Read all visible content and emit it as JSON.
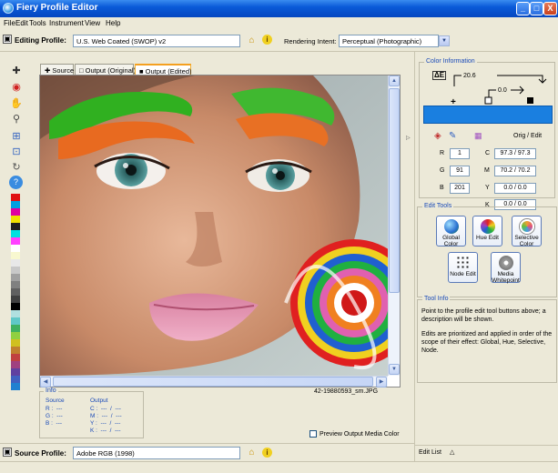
{
  "window": {
    "title": "Fiery Profile Editor",
    "minimize": "_",
    "maximize": "□",
    "close": "X"
  },
  "menu": [
    "File",
    "Edit",
    "Tools",
    "Instrument",
    "View",
    "Help"
  ],
  "toolbar": {
    "editing_label": "Editing Profile:",
    "editing_value": "U.S. Web Coated (SWOP) v2",
    "rendering_label": "Rendering Intent:",
    "rendering_value": "Perceptual (Photographic)"
  },
  "tabs": [
    {
      "label": "Source",
      "icon": "plus-icon"
    },
    {
      "label": "Output (Original)",
      "icon": "hollow-square-icon"
    },
    {
      "label": "Output (Edited)",
      "icon": "filled-square-icon",
      "active": true
    }
  ],
  "left_tools": [
    "eyedropper-plus-icon",
    "target-icon",
    "hand-icon",
    "zoom-icon",
    "fit-icon",
    "actual-size-icon",
    "rotate-icon",
    "help-icon"
  ],
  "swatches": [
    "#e01010",
    "#00a0e0",
    "#e000a0",
    "#f0e000",
    "#202020",
    "#00e0e0",
    "#ff40ff",
    "#ffffff",
    "#f8f8d0",
    "#e8e8e8",
    "#c8c8c8",
    "#a0a0a0",
    "#808080",
    "#606060",
    "#404040",
    "#000000",
    "#b0e0e0",
    "#60c8c8",
    "#40b060",
    "#90d040",
    "#d0c020",
    "#c08030",
    "#c04040",
    "#a04080",
    "#6040a0",
    "#4060c0",
    "#2080d0"
  ],
  "image": {
    "filename": "42-19880593_sm.JPG"
  },
  "info": {
    "legend": "Info",
    "source_title": "Source",
    "output_title": "Output",
    "source_lines": [
      "R :  ---",
      "G :  ---",
      "B :  ---"
    ],
    "output_lines": [
      "C :  ---  /  ---",
      "M :  ---  /  ---",
      "Y :  ---  /  ---",
      "K :  ---  /  ---"
    ]
  },
  "preview_label": "Preview Output Media Color",
  "source_profile": {
    "label": "Source Profile:",
    "value": "Adobe RGB (1998)"
  },
  "color_info": {
    "legend": "Color Information",
    "top_value": "20.6",
    "mid_value": "0.0",
    "orig_edit_label": "Orig / Edit",
    "rgb": [
      {
        "label": "R",
        "value": "1"
      },
      {
        "label": "G",
        "value": "91"
      },
      {
        "label": "B",
        "value": "201"
      }
    ],
    "cmyk": [
      {
        "label": "C",
        "value": "97.3 / 97.3"
      },
      {
        "label": "M",
        "value": "70.2 / 70.2"
      },
      {
        "label": "Y",
        "value": "0.0 / 0.0"
      },
      {
        "label": "K",
        "value": "0.0 / 0.0"
      }
    ]
  },
  "edit_tools": {
    "legend": "Edit Tools",
    "buttons": [
      {
        "label": "Global Color",
        "icon": "globe-icon"
      },
      {
        "label": "Hue Edit",
        "icon": "color-wheel-icon"
      },
      {
        "label": "Selective Color",
        "icon": "crosshair-icon"
      },
      {
        "label": "Node Edit",
        "icon": "node-grid-icon"
      },
      {
        "label": "Media Whitepoint",
        "icon": "media-whitepoint-icon"
      }
    ]
  },
  "tool_info": {
    "legend": "Tool Info",
    "text1": "Point to the profile edit tool buttons above; a description will be shown.",
    "text2": "Edits are prioritized and applied in order of the scope of their effect: Global, Hue, Selective, Node."
  },
  "edit_list": {
    "label": "Edit List",
    "icon": "triangle-up-icon"
  },
  "colors": {
    "accent": "#1a7fe0",
    "titlebar": "#0a5ad8",
    "legend": "#1a4ab8"
  }
}
